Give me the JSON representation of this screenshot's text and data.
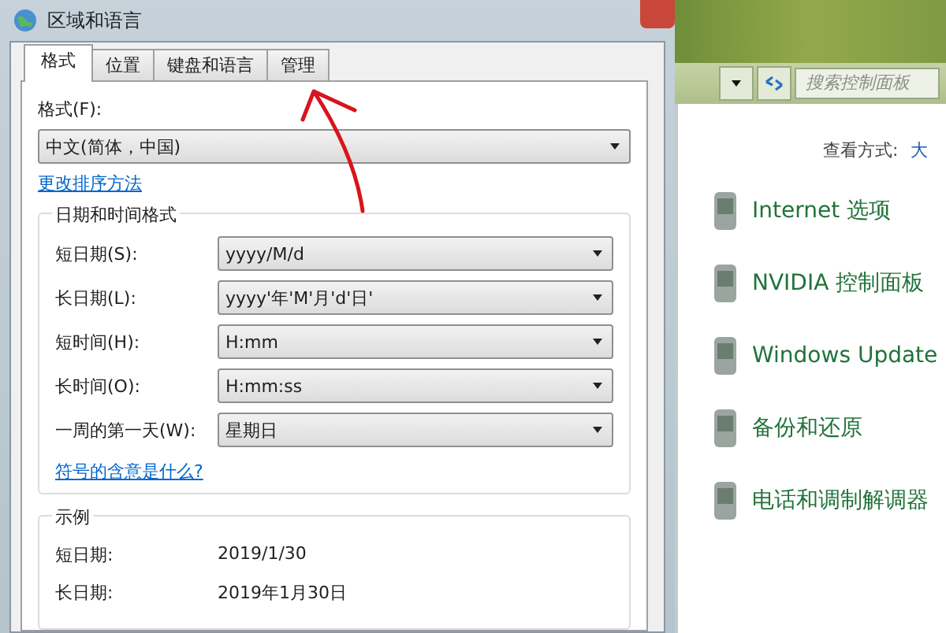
{
  "dialog": {
    "title": "区域和语言",
    "tabs": [
      {
        "label": "格式",
        "selected": true
      },
      {
        "label": "位置",
        "selected": false
      },
      {
        "label": "键盘和语言",
        "selected": false
      },
      {
        "label": "管理",
        "selected": false
      }
    ],
    "format_label": "格式(F):",
    "format_value": "中文(简体，中国)",
    "sort_link": "更改排序方法",
    "datetime_group": {
      "title": "日期和时间格式",
      "rows": [
        {
          "label": "短日期(S):",
          "value": "yyyy/M/d"
        },
        {
          "label": "长日期(L):",
          "value": "yyyy'年'M'月'd'日'"
        },
        {
          "label": "短时间(H):",
          "value": "H:mm"
        },
        {
          "label": "长时间(O):",
          "value": "H:mm:ss"
        },
        {
          "label": "一周的第一天(W):",
          "value": "星期日"
        }
      ],
      "link": "符号的含意是什么?"
    },
    "example_group": {
      "title": "示例",
      "rows": [
        {
          "label": "短日期:",
          "value": "2019/1/30"
        },
        {
          "label": "长日期:",
          "value": "2019年1月30日"
        }
      ]
    }
  },
  "control_panel": {
    "search": {
      "placeholder": "搜索控制面板"
    },
    "view_label": "查看方式:",
    "view_value": "大",
    "items": [
      {
        "label": "Internet 选项"
      },
      {
        "label": "NVIDIA 控制面板"
      },
      {
        "label": "Windows Update"
      },
      {
        "label": "备份和还原"
      },
      {
        "label": "电话和调制解调器"
      }
    ]
  }
}
